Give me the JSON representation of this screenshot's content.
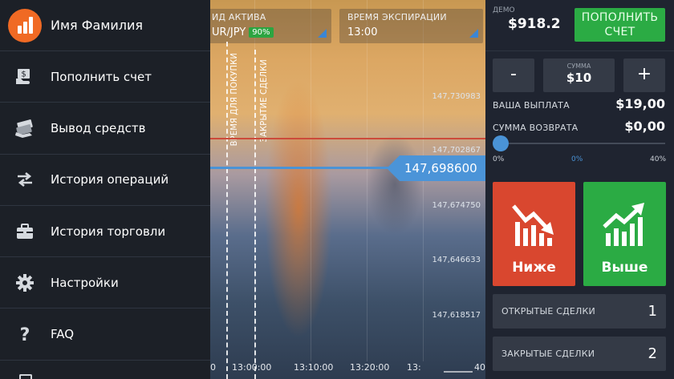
{
  "drawer": {
    "user_name": "Имя Фамилия",
    "items": [
      {
        "label": "Пополнить счет",
        "icon": "deposit-icon"
      },
      {
        "label": "Вывод средств",
        "icon": "withdraw-icon"
      },
      {
        "label": "История операций",
        "icon": "transfer-arrows-icon"
      },
      {
        "label": "История торговли",
        "icon": "briefcase-icon"
      },
      {
        "label": "Настройки",
        "icon": "gear-icon"
      },
      {
        "label": "FAQ",
        "icon": "question-icon"
      }
    ]
  },
  "chart": {
    "asset_caption": "ИД АКТИВА",
    "asset_value": "UR/JPY",
    "payout_badge": "90%",
    "expiry_caption": "ВРЕМЯ ЭКСПИРАЦИИ",
    "expiry_value": "13:00",
    "purchase_line_label": "ВРЕМЯ ДЛЯ ПОКУПКИ",
    "close_line_label": "ЗАКРЫТИЕ СДЕЛКИ",
    "current_price": "147,698600",
    "price_labels": [
      "147,730983",
      "147,702867",
      "147,674750",
      "147,646633",
      "147,618517"
    ],
    "time_labels": [
      "0",
      "13:00:00",
      "13:10:00",
      "13:20:00",
      "13:",
      "40"
    ]
  },
  "panel": {
    "demo_caption": "ДЕМО",
    "demo_balance": "$918.2",
    "topup_button": "ПОПОЛНИТЬ СЧЕТ",
    "minus_label": "-",
    "plus_label": "+",
    "sum_caption": "СУММА",
    "sum_value": "$10",
    "payout_label": "ВАША ВЫПЛАТА",
    "payout_value": "$19,00",
    "refund_label": "СУММА ВОЗВРАТА",
    "refund_value": "$0,00",
    "slider_min": "0%",
    "slider_current": "0%",
    "slider_max": "40%",
    "slider_level": 0,
    "down_button": "Ниже",
    "up_button": "Выше",
    "open_deals_label": "ОТКРЫТЫЕ СДЕЛКИ",
    "open_deals_count": "1",
    "closed_deals_label": "ЗАКРЫТЫЕ СДЕЛКИ",
    "closed_deals_count": "2"
  },
  "colors": {
    "accent_blue": "#4a93d6",
    "buy_green": "#2bab44",
    "sell_red": "#d9472f",
    "avatar_orange": "#f06a24"
  }
}
